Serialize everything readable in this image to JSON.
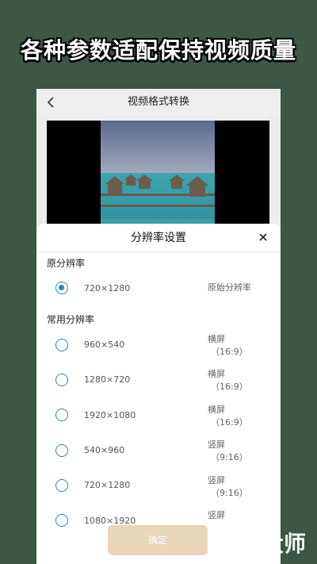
{
  "banner": {
    "text": "各种参数适配保持视频质量"
  },
  "app": {
    "title": "视频格式转换",
    "back_icon": "chevron-left-icon"
  },
  "sheet": {
    "title": "分辨率设置",
    "close_icon": "close-icon",
    "original_section": "原分辨率",
    "original": {
      "value": "720×1280",
      "label": "原始分辨率",
      "checked": true
    },
    "common_section": "常用分辨率",
    "options": [
      {
        "value": "960×540",
        "orient": "横屏",
        "ratio": "（16:9）"
      },
      {
        "value": "1280×720",
        "orient": "横屏",
        "ratio": "（16:9）"
      },
      {
        "value": "1920×1080",
        "orient": "横屏",
        "ratio": "（16:9）"
      },
      {
        "value": "540×960",
        "orient": "竖屏",
        "ratio": "（9:16）"
      },
      {
        "value": "720×1280",
        "orient": "竖屏",
        "ratio": "（9:16）"
      },
      {
        "value": "1080×1920",
        "orient": "竖屏",
        "ratio": ""
      }
    ],
    "confirm_label": "确定"
  },
  "watermark": {
    "text": "大师"
  },
  "colors": {
    "accent": "#2d86b3",
    "background": "#3d5645",
    "confirm": "#e9d5b8"
  }
}
